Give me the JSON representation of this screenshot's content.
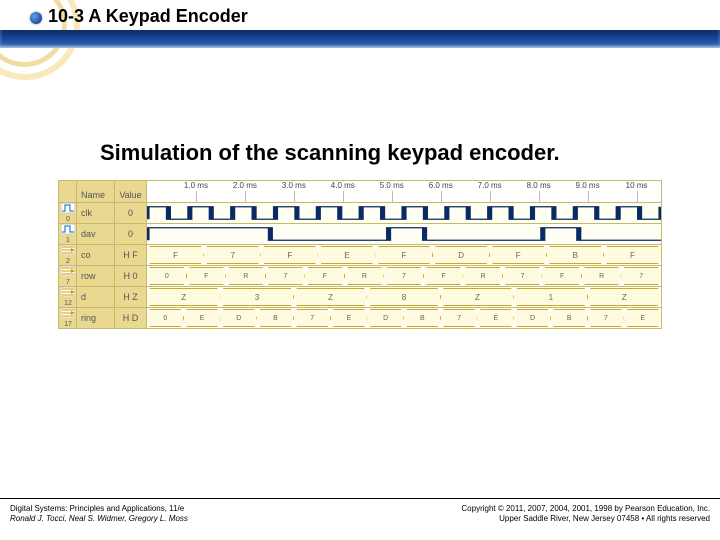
{
  "header": {
    "title": "10-3 A Keypad Encoder"
  },
  "subheading": "Simulation of the scanning keypad encoder.",
  "sim": {
    "columns": {
      "name_header": "Name",
      "value_header": "Value"
    },
    "time_ticks": [
      "1.0 ms",
      "2.0 ms",
      "3.0 ms",
      "4.0 ms",
      "5.0 ms",
      "6.0 ms",
      "7.0 ms",
      "8.0 ms",
      "9.0 ms",
      "10 ms"
    ],
    "rows": [
      {
        "icon": "wave",
        "port": "0",
        "name": "clk",
        "value": "0",
        "type": "clock"
      },
      {
        "icon": "wave",
        "port": "1",
        "name": "dav",
        "value": "0",
        "type": "digital",
        "edges": [
          0.0,
          0.24,
          0.47,
          0.54,
          0.77,
          0.84
        ]
      },
      {
        "icon": "bus",
        "port": "2",
        "name": "co",
        "value": "H F",
        "type": "bus",
        "segments": [
          "F",
          "7",
          "F",
          "E",
          "F",
          "D",
          "F",
          "B",
          "F"
        ]
      },
      {
        "icon": "bus",
        "port": "7",
        "name": "row",
        "value": "H 0",
        "type": "bus",
        "segments": [
          "0",
          "F",
          "R",
          "7",
          "F",
          "R",
          "7",
          "F",
          "R",
          "7",
          "F",
          "R",
          "7"
        ]
      },
      {
        "icon": "bus",
        "port": "12",
        "name": "d",
        "value": "H Z",
        "type": "bus",
        "segments": [
          "Z",
          "3",
          "Z",
          "8",
          "Z",
          "1",
          "Z"
        ]
      },
      {
        "icon": "bus",
        "port": "17",
        "name": "ring",
        "value": "H D",
        "type": "bus",
        "segments": [
          "0",
          "E",
          "D",
          "B",
          "7",
          "E",
          "D",
          "B",
          "7",
          "E",
          "D",
          "B",
          "7",
          "E"
        ]
      }
    ]
  },
  "footer": {
    "left_line1": "Digital Systems: Principles and Applications, 11/e",
    "left_line2": "Ronald J. Tocci, Neal S. Widmer, Gregory L. Moss",
    "right_line1": "Copyright © 2011, 2007, 2004, 2001, 1998 by Pearson Education, Inc.",
    "right_line2": "Upper Saddle River, New Jersey 07458 • All rights reserved"
  },
  "chart_data": {
    "type": "table",
    "title": "Simulation waveform of scanning keypad encoder",
    "time_axis_ms": [
      1.0,
      2.0,
      3.0,
      4.0,
      5.0,
      6.0,
      7.0,
      8.0,
      9.0,
      10.0
    ],
    "signals": {
      "clk": {
        "kind": "clock",
        "initial": 0
      },
      "dav": {
        "kind": "digital",
        "initial": 0,
        "high_intervals_frac": [
          [
            0.0,
            0.24
          ],
          [
            0.47,
            0.54
          ],
          [
            0.77,
            0.84
          ]
        ]
      },
      "co": {
        "kind": "bus_hex",
        "initial": "HF",
        "sequence": [
          "F",
          "7",
          "F",
          "E",
          "F",
          "D",
          "F",
          "B",
          "F"
        ]
      },
      "row": {
        "kind": "bus_hex",
        "initial": "H0",
        "sequence": [
          "0",
          "F",
          "R",
          "7",
          "F",
          "R",
          "7",
          "F",
          "R",
          "7",
          "F",
          "R",
          "7"
        ]
      },
      "d": {
        "kind": "bus_hex",
        "initial": "HZ",
        "sequence": [
          "Z",
          "3",
          "Z",
          "8",
          "Z",
          "1",
          "Z"
        ]
      },
      "ring": {
        "kind": "bus_hex",
        "initial": "HD",
        "sequence": [
          "0",
          "E",
          "D",
          "B",
          "7",
          "E",
          "D",
          "B",
          "7",
          "E",
          "D",
          "B",
          "7",
          "E"
        ]
      }
    }
  }
}
